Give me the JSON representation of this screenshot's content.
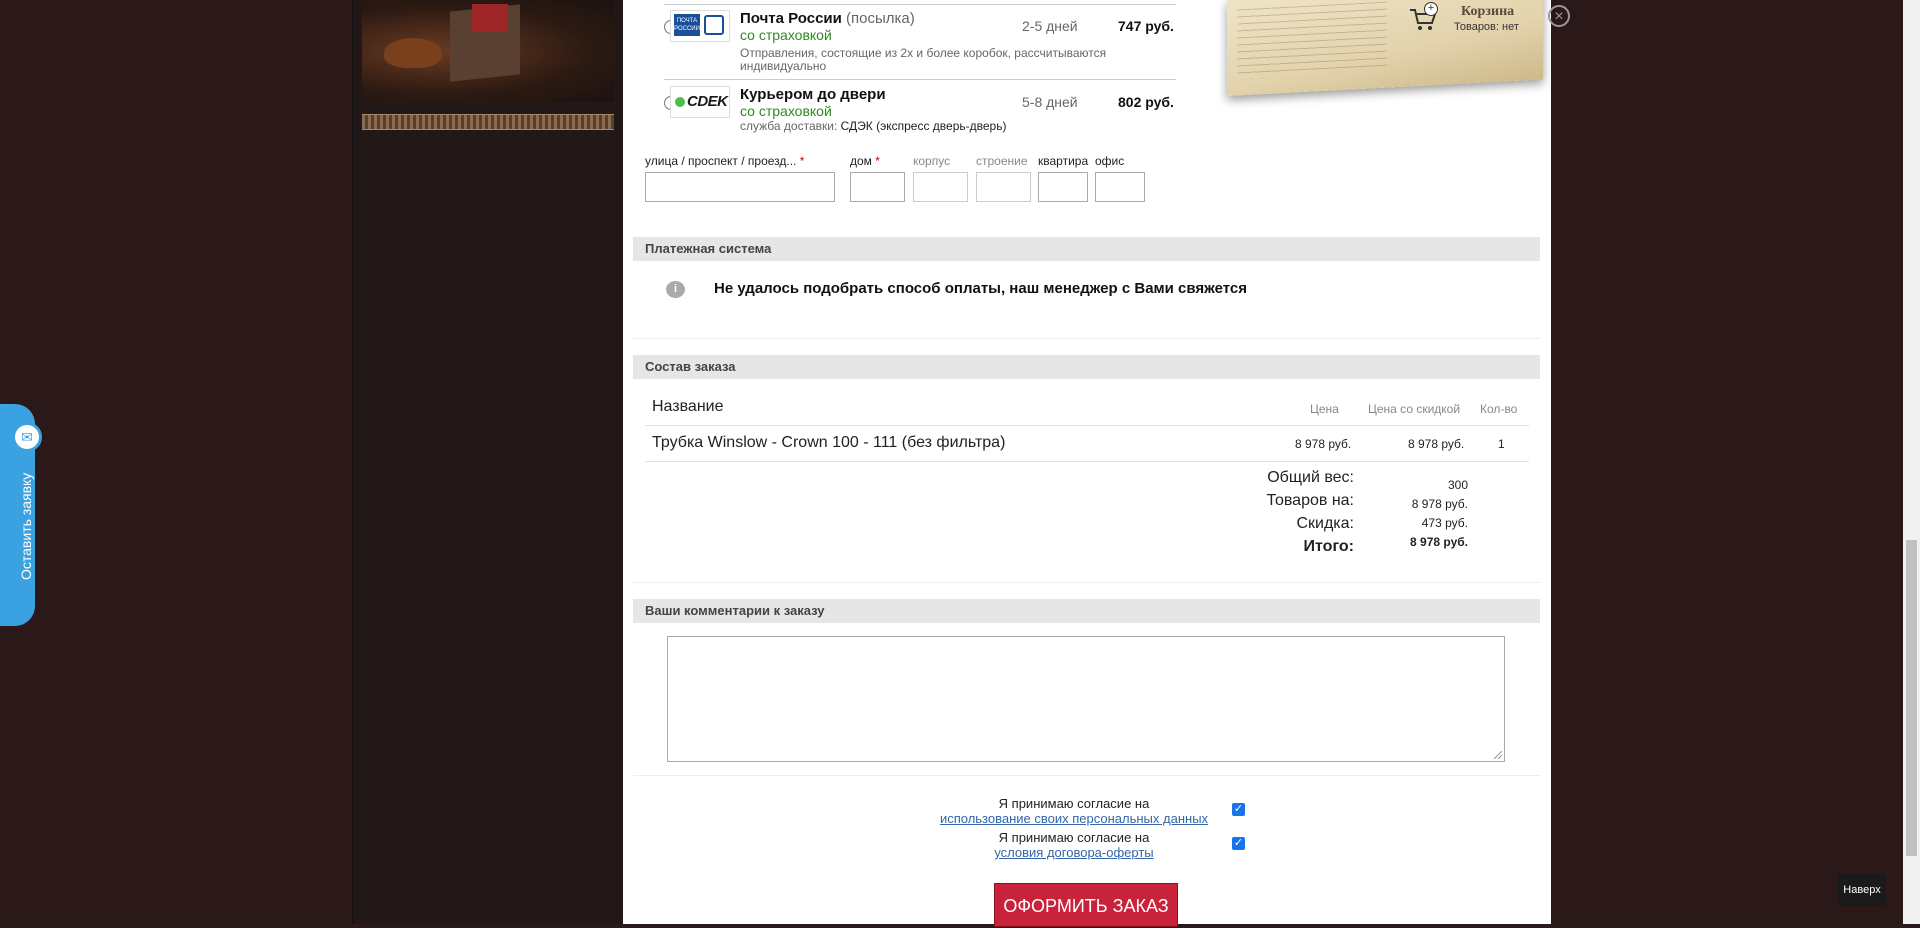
{
  "delivery": {
    "options": [
      {
        "title": "Почта России",
        "extra": "(посылка)",
        "insurance": "со страховкой",
        "note": "Отправления, состоящие из 2х и более коробок, рассчитываются индивидуально",
        "days": "2-5 дней",
        "price": "747 руб.",
        "logo_text": "ПОЧТА РОССИИ"
      },
      {
        "title": "Курьером до двери",
        "extra": "",
        "insurance": "со страховкой",
        "note_prefix": "служба доставки:",
        "note_service": "СДЭК (экспресс дверь-дверь)",
        "days": "5-8 дней",
        "price": "802 руб.",
        "logo_text": "CDEK"
      }
    ]
  },
  "address": {
    "street_label": "улица / проспект / проезд...",
    "house_label": "дом",
    "korpus_label": "корпус",
    "building_label": "строение",
    "apartment_label": "квартира",
    "office_label": "офис",
    "required_mark": "*"
  },
  "payment": {
    "header": "Платежная система",
    "icon_text": "i",
    "message": "Не удалось подобрать способ оплаты, наш менеджер с Вами свяжется"
  },
  "order": {
    "header": "Состав заказа",
    "columns": {
      "name": "Название",
      "price": "Цена",
      "discount_price": "Цена со скидкой",
      "qty": "Кол-во"
    },
    "items": [
      {
        "name": "Трубка Winslow - Crown 100 - 111 (без фильтра)",
        "price": "8 978 руб.",
        "discount_price": "8 978 руб.",
        "qty": "1"
      }
    ],
    "totals": {
      "weight_label": "Общий вес:",
      "weight_value": "300",
      "goods_label": "Товаров на:",
      "goods_value": "8 978 руб.",
      "discount_label": "Скидка:",
      "discount_value": "473 руб.",
      "total_label": "Итого:",
      "total_value": "8 978 руб."
    }
  },
  "comments": {
    "header": "Ваши комментарии к заказу",
    "value": ""
  },
  "consents": [
    {
      "text": "Я принимаю согласие на",
      "link": "использование своих персональных данных",
      "checked": true
    },
    {
      "text": "Я принимаю согласие на",
      "link": "условия договора-оферты",
      "checked": true
    }
  ],
  "submit_label": "ОФОРМИТЬ ЗАКАЗ",
  "cart": {
    "title": "Корзина",
    "subtitle": "Товаров: нет"
  },
  "feedback_tab_label": "Оставить заявку",
  "scroll_top_label": "Наверх",
  "colors": {
    "accent_red": "#c8233a",
    "insurance_green": "#2e8a1e",
    "feedback_blue": "#3aa2e0",
    "link_blue": "#3366aa"
  }
}
